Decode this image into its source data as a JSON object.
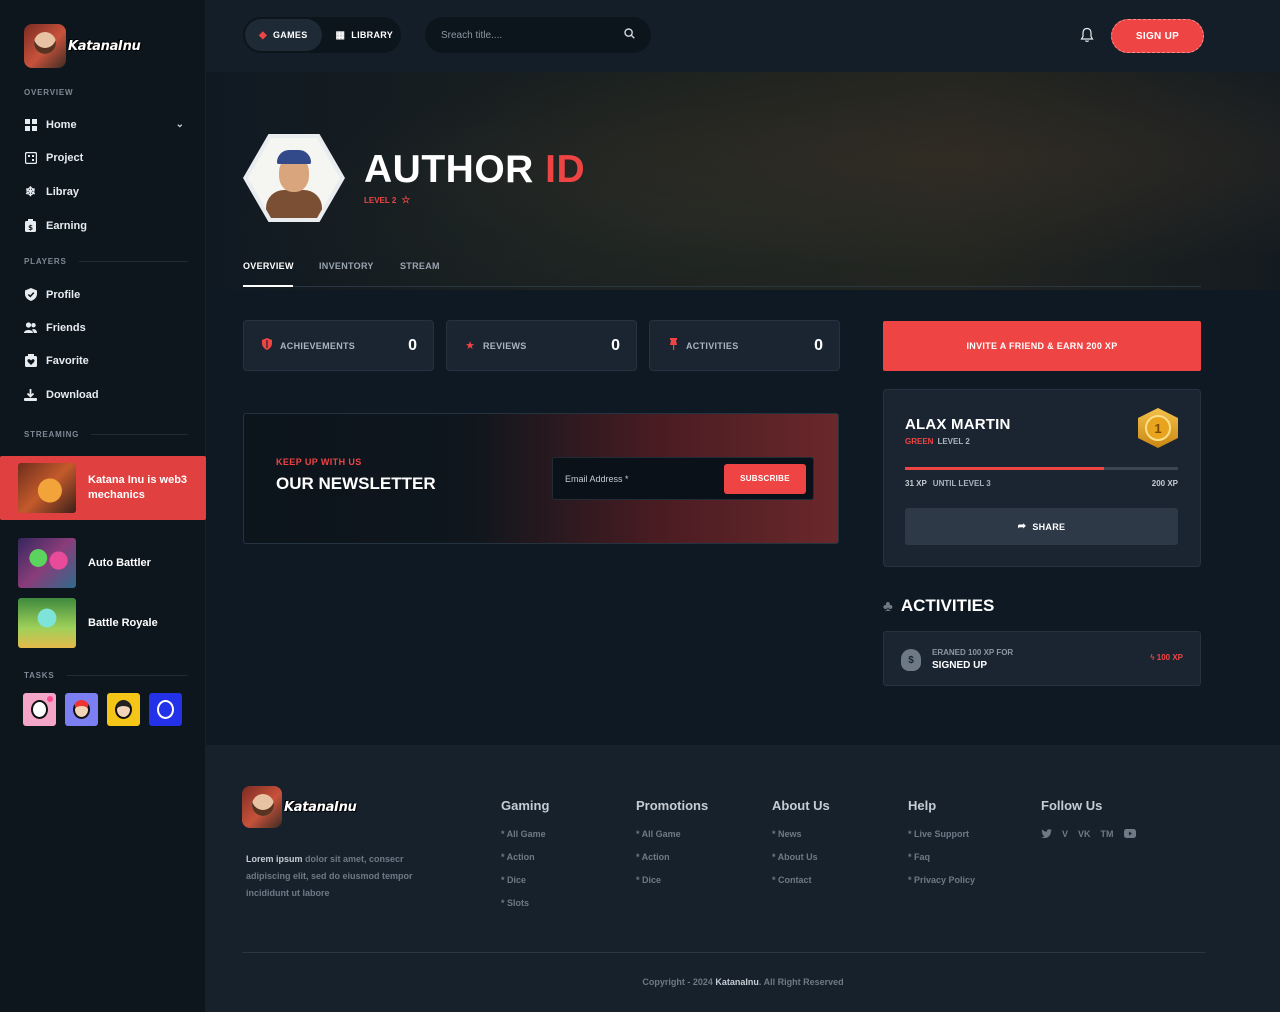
{
  "brand": {
    "name": "KatanaInu"
  },
  "sidebar": {
    "sections": {
      "overview": "OVERVIEW",
      "players": "PLAYERS",
      "streaming": "STREAMING",
      "tasks": "TASKS"
    },
    "overview_items": [
      {
        "label": "Home",
        "icon": "grid-icon"
      },
      {
        "label": "Project",
        "icon": "gamepad-icon"
      },
      {
        "label": "Libray",
        "icon": "snowflake-icon"
      },
      {
        "label": "Earning",
        "icon": "wallet-icon"
      }
    ],
    "player_items": [
      {
        "label": "Profile",
        "icon": "shield-check-icon"
      },
      {
        "label": "Friends",
        "icon": "users-icon"
      },
      {
        "label": "Favorite",
        "icon": "heart-box-icon"
      },
      {
        "label": "Download",
        "icon": "download-icon"
      }
    ],
    "streams": [
      {
        "label": "Katana Inu is web3 mechanics",
        "active": true
      },
      {
        "label": "Auto Battler",
        "active": false
      },
      {
        "label": "Battle Royale",
        "active": false
      }
    ]
  },
  "topbar": {
    "games": "GAMES",
    "library": "LIBRARY",
    "search_placeholder": "Sreach title....",
    "signup": "SIGN UP"
  },
  "profile": {
    "title_main": "AUTHOR",
    "title_accent": "ID",
    "level": "LEVEL 2"
  },
  "tabs": [
    "OVERVIEW",
    "INVENTORY",
    "STREAM"
  ],
  "stats": [
    {
      "label": "ACHIEVEMENTS",
      "value": "0",
      "icon": "shield-icon"
    },
    {
      "label": "REVIEWS",
      "value": "0",
      "icon": "star-icon"
    },
    {
      "label": "ACTIVITIES",
      "value": "0",
      "icon": "pin-icon"
    }
  ],
  "newsletter": {
    "kicker": "KEEP UP WITH US",
    "title": "OUR NEWSLETTER",
    "placeholder": "Email Address *",
    "button": "SUBSCRIBE"
  },
  "invite": "INVITE A FRIEND & EARN 200 XP",
  "player": {
    "name": "ALAX MARTIN",
    "rank": "GREEN",
    "level": "LEVEL 2",
    "badge": "1",
    "xp_current": "31 XP",
    "xp_until": "UNTIL LEVEL 3",
    "xp_target": "200 XP",
    "progress": 0.73,
    "share": "SHARE"
  },
  "activities": {
    "heading": "ACTIVITIES",
    "items": [
      {
        "pre": "ERANED 100 XP FOR",
        "main": "SIGNED UP",
        "xp": "100 XP"
      }
    ]
  },
  "footer": {
    "desc_bold": "Lorem ipsum",
    "desc_rest": " dolor sit amet, consecr adipiscing elit, sed do eiusmod tempor incididunt ut labore",
    "columns": [
      {
        "title": "Gaming",
        "links": [
          "* All Game",
          "* Action",
          "* Dice",
          "* Slots"
        ]
      },
      {
        "title": "Promotions",
        "links": [
          "* All Game",
          "* Action",
          "* Dice"
        ]
      },
      {
        "title": "About Us",
        "links": [
          "* News",
          "* About Us",
          "* Contact"
        ]
      },
      {
        "title": "Help",
        "links": [
          "* Live Support",
          "* Faq",
          "* Privacy Policy"
        ]
      }
    ],
    "follow_title": "Follow Us",
    "social": [
      "twitter-icon",
      "vimeo-icon",
      "vk-icon",
      "tm-icon",
      "youtube-icon"
    ],
    "copy_pre": "Copyright - 2024 ",
    "copy_brand": "KatanaInu",
    "copy_post": ". All Right Reserved"
  },
  "colors": {
    "accent": "#ef4444",
    "bg": "#0f1923",
    "card": "#1a2531"
  }
}
